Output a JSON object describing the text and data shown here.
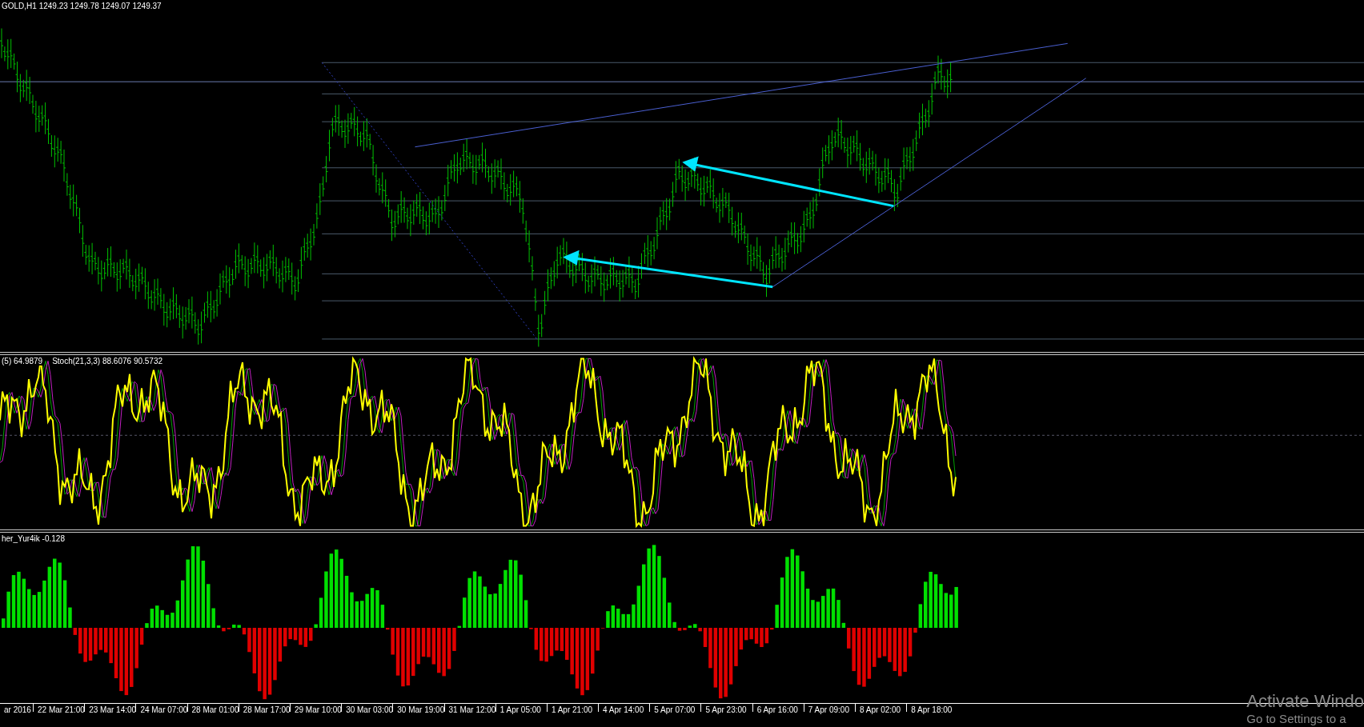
{
  "panels": [
    {
      "kind": "price",
      "labels": [
        "GOLD,H1  1249.23 1249.78 1249.07 1249.37"
      ]
    },
    {
      "kind": "oscillator",
      "labels": [
        "(5) 64.9879",
        "Stoch(21,3,3) 88.6076 90.5732"
      ]
    },
    {
      "kind": "histogram",
      "labels": [
        "her_Yur4ik -0.128"
      ]
    }
  ],
  "time_axis": [
    "ar 2016",
    "22 Mar 21:00",
    "23 Mar 14:00",
    "24 Mar 07:00",
    "28 Mar 01:00",
    "28 Mar 17:00",
    "29 Mar 10:00",
    "30 Mar 03:00",
    "30 Mar 19:00",
    "31 Mar 12:00",
    "1 Apr 05:00",
    "1 Apr 21:00",
    "4 Apr 14:00",
    "5 Apr 07:00",
    "5 Apr 23:00",
    "6 Apr 16:00",
    "7 Apr 09:00",
    "8 Apr 02:00",
    "8 Apr 18:00"
  ],
  "watermark": {
    "title": "Activate Windo",
    "subtitle": "Go to Settings to a"
  }
}
